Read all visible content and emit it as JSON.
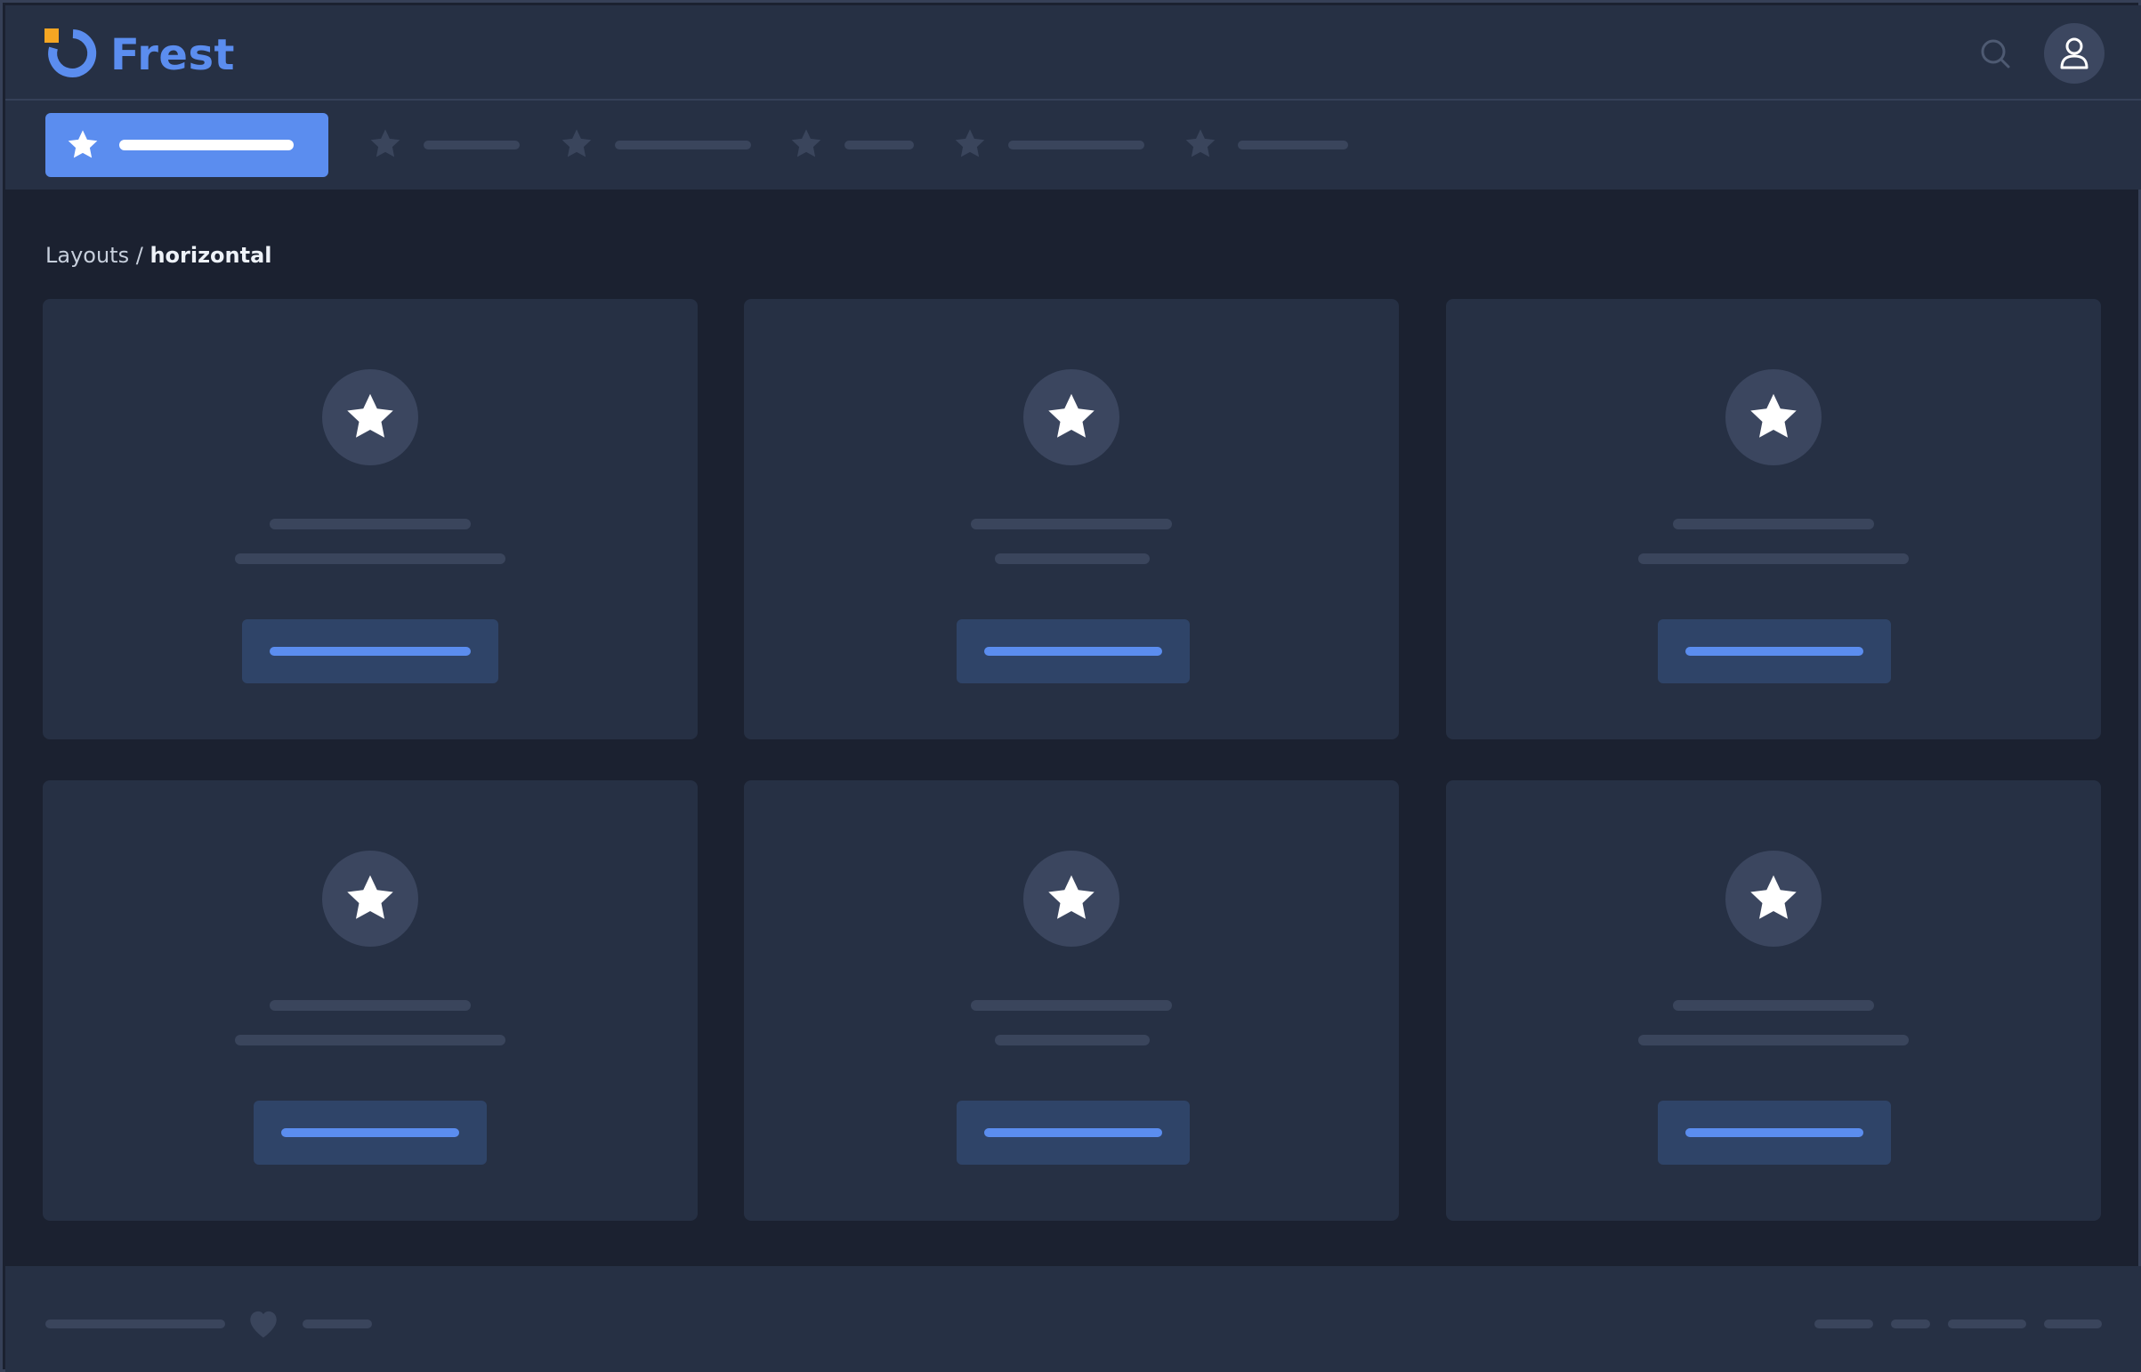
{
  "app": {
    "brand": "Frest"
  },
  "breadcrumb": {
    "parent": "Layouts",
    "separator": " / ",
    "current": "horizontal"
  },
  "icons": {
    "logo": "frest-logo-icon",
    "search": "search-icon",
    "user": "user-icon",
    "nav": "star-icon",
    "card": "star-icon",
    "footer": "heart-icon"
  },
  "colors": {
    "accent": "#5b8def",
    "logo_square": "#f5a623",
    "background": "#1b2130",
    "surface": "#263044",
    "placeholder": "#3a455c"
  },
  "nav": {
    "item_count": 6,
    "active_index": 0
  },
  "cards": {
    "count": 6,
    "columns": 3
  }
}
